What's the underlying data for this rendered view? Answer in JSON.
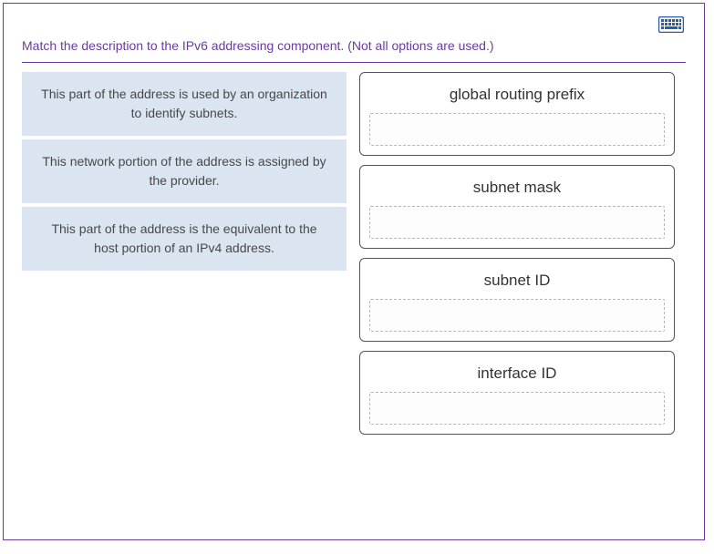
{
  "prompt": "Match the description to the IPv6 addressing component. (Not all options are used.)",
  "descriptions": [
    "This part of the address is used by an organization to identify subnets.",
    "This network portion of the address is assigned by the provider.",
    "This part of the address is the equivalent to the host portion of an IPv4 address."
  ],
  "targets": [
    {
      "label": "global routing prefix"
    },
    {
      "label": "subnet mask"
    },
    {
      "label": "subnet ID"
    },
    {
      "label": "interface ID"
    }
  ]
}
